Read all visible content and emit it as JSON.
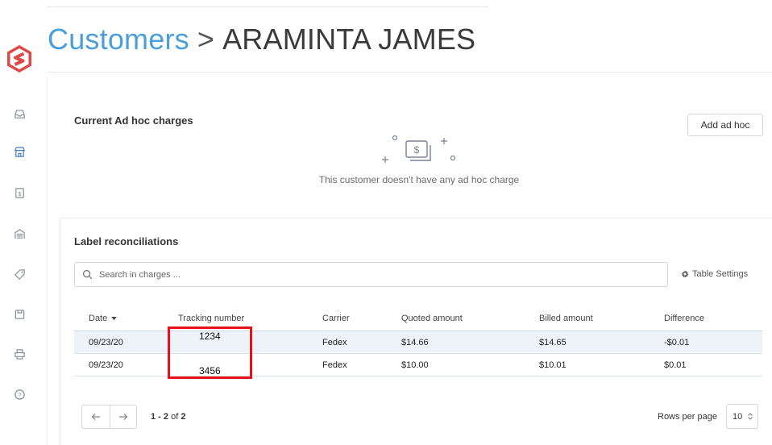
{
  "header": {
    "breadcrumb_parent": "Customers",
    "separator": ">",
    "customer_name": "ARAMINTA JAMES"
  },
  "sidebar": {
    "logo": "shipping-logo",
    "items": [
      {
        "icon": "inbox-icon"
      },
      {
        "icon": "store-icon"
      },
      {
        "icon": "dollar-icon"
      },
      {
        "icon": "warehouse-icon"
      },
      {
        "icon": "tag-icon"
      },
      {
        "icon": "box-icon"
      },
      {
        "icon": "printer-icon"
      },
      {
        "icon": "help-icon"
      }
    ]
  },
  "adhoc": {
    "title": "Current Ad hoc charges",
    "add_button": "Add ad hoc",
    "empty_message": "This customer doesn't have any ad hoc charge"
  },
  "reconciliation": {
    "title": "Label reconciliations",
    "search_placeholder": "Search in charges ...",
    "table_settings": "Table Settings",
    "columns": {
      "date": "Date",
      "tracking": "Tracking number",
      "carrier": "Carrier",
      "quoted": "Quoted amount",
      "billed": "Billed amount",
      "difference": "Difference"
    },
    "rows": [
      {
        "date": "09/23/20",
        "carrier": "Fedex",
        "quoted": "$14.66",
        "billed": "$14.65",
        "difference": "-$0.01"
      },
      {
        "date": "09/23/20",
        "carrier": "Fedex",
        "quoted": "$10.00",
        "billed": "$10.01",
        "difference": "$0.01"
      }
    ],
    "annotation": {
      "tracking_1": "1234",
      "tracking_2": "3456",
      "color": "#e8101a"
    }
  },
  "pagination": {
    "range": "1 - 2",
    "of_label": "of",
    "total": "2",
    "rows_per_page_label": "Rows per page",
    "rows_per_page_value": "10"
  },
  "colors": {
    "accent": "#4a9fd8",
    "logo": "#e04848",
    "selected_row": "#eef3fa"
  }
}
